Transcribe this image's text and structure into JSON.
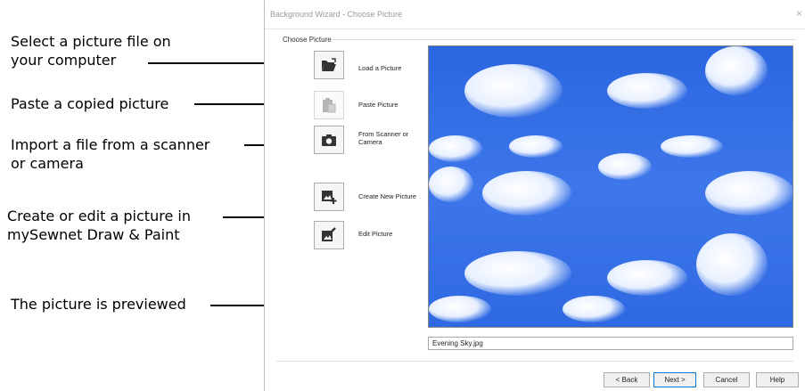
{
  "callouts": {
    "select": "Select a picture file on your computer",
    "select_l1": "Select a picture file on",
    "select_l2": "your computer",
    "paste": "Paste a copied picture",
    "import_l1": "Import a file from a scanner",
    "import_l2": "or camera",
    "create_l1": "Create or edit a picture in",
    "create_l2": "mySewnet Draw & Paint",
    "preview": "The picture is previewed"
  },
  "dialog": {
    "title": "Background Wizard - Choose Picture",
    "close": "×",
    "group_label": "Choose Picture",
    "actions": [
      {
        "label": "Load a Picture",
        "icon": "folder-open-icon",
        "enabled": true
      },
      {
        "label": "Paste Picture",
        "icon": "clipboard-paste-icon",
        "enabled": false
      },
      {
        "label_l1": "From Scanner or",
        "label_l2": "Camera",
        "icon": "camera-icon",
        "enabled": true
      },
      {
        "label": "Create New Picture",
        "icon": "new-picture-icon",
        "enabled": true
      },
      {
        "label": "Edit Picture",
        "icon": "edit-picture-icon",
        "enabled": true
      }
    ],
    "filename": "Evening Sky.jpg",
    "buttons": {
      "back": "< Back",
      "next": "Next >",
      "cancel": "Cancel",
      "help": "Help"
    }
  },
  "colors": {
    "sky": "#3a73e8",
    "accent": "#0078d7"
  }
}
